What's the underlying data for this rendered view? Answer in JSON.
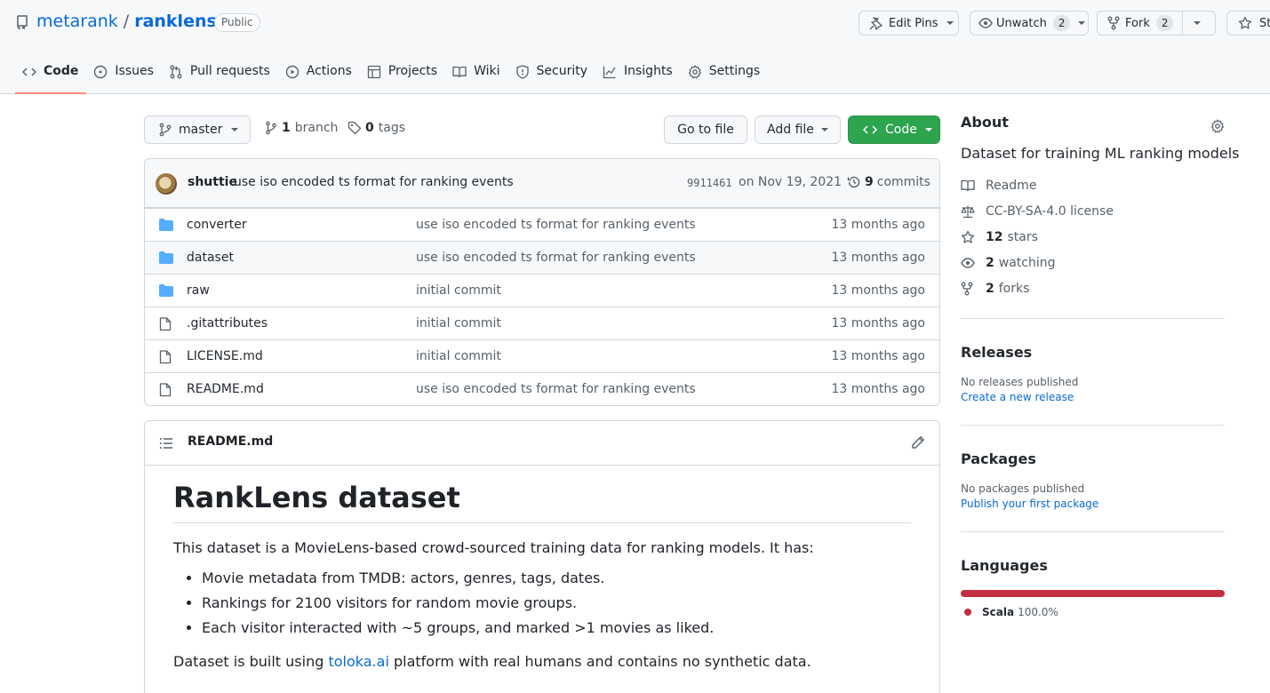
{
  "repo": {
    "owner": "metarank",
    "separator": "/",
    "name": "ranklens",
    "visibility": "Public"
  },
  "header_buttons": {
    "edit_pins": "Edit Pins",
    "unwatch": "Unwatch",
    "unwatch_count": "2",
    "fork": "Fork",
    "fork_count": "2",
    "star": "St"
  },
  "tabs": [
    {
      "label": "Code",
      "icon": "code-icon",
      "active": true
    },
    {
      "label": "Issues",
      "icon": "issue-icon"
    },
    {
      "label": "Pull requests",
      "icon": "pull-request-icon"
    },
    {
      "label": "Actions",
      "icon": "play-icon"
    },
    {
      "label": "Projects",
      "icon": "table-icon"
    },
    {
      "label": "Wiki",
      "icon": "book-icon"
    },
    {
      "label": "Security",
      "icon": "shield-icon"
    },
    {
      "label": "Insights",
      "icon": "graph-icon"
    },
    {
      "label": "Settings",
      "icon": "gear-icon"
    }
  ],
  "branch_bar": {
    "branch": "master",
    "branch_count": "1",
    "branch_label": "branch",
    "tag_count": "0",
    "tag_label": "tags",
    "go_to_file": "Go to file",
    "add_file": "Add file",
    "code": "Code"
  },
  "latest_commit": {
    "author": "shuttie",
    "message": "use iso encoded ts format for ranking events",
    "sha": "9911461",
    "date": "on Nov 19, 2021",
    "commit_count": "9",
    "commit_label": "commits"
  },
  "files": [
    {
      "name": "converter",
      "type": "dir",
      "message": "use iso encoded ts format for ranking events",
      "age": "13 months ago"
    },
    {
      "name": "dataset",
      "type": "dir",
      "message": "use iso encoded ts format for ranking events",
      "age": "13 months ago"
    },
    {
      "name": "raw",
      "type": "dir",
      "message": "initial commit",
      "age": "13 months ago"
    },
    {
      "name": ".gitattributes",
      "type": "file",
      "message": "initial commit",
      "age": "13 months ago"
    },
    {
      "name": "LICENSE.md",
      "type": "file",
      "message": "initial commit",
      "age": "13 months ago"
    },
    {
      "name": "README.md",
      "type": "file",
      "message": "use iso encoded ts format for ranking events",
      "age": "13 months ago"
    }
  ],
  "readme": {
    "filename": "README.md",
    "heading": "RankLens dataset",
    "intro": "This dataset is a MovieLens-based crowd-sourced training data for ranking models. It has:",
    "bullets": [
      "Movie metadata from TMDB: actors, genres, tags, dates.",
      "Rankings for 2100 visitors for random movie groups.",
      "Each visitor interacted with ~5 groups, and marked >1 movies as liked."
    ],
    "built_prefix": "Dataset is built using ",
    "built_link": "toloka.ai",
    "built_suffix": " platform with real humans and contains no synthetic data."
  },
  "about": {
    "title": "About",
    "description": "Dataset for training ML ranking models",
    "readme": "Readme",
    "license": "CC-BY-SA-4.0 license",
    "stars_count": "12",
    "stars_label": "stars",
    "watching_count": "2",
    "watching_label": "watching",
    "forks_count": "2",
    "forks_label": "forks"
  },
  "releases": {
    "title": "Releases",
    "empty": "No releases published",
    "link": "Create a new release"
  },
  "packages": {
    "title": "Packages",
    "empty": "No packages published",
    "link": "Publish your first package"
  },
  "languages": {
    "title": "Languages",
    "items": [
      {
        "name": "Scala",
        "percent": "100.0%",
        "color": "#c22d40"
      }
    ]
  },
  "colors": {
    "link": "#0969da",
    "primary_button": "#2da44e",
    "active_tab_underline": "#fd8c73",
    "folder": "#54aeff"
  }
}
